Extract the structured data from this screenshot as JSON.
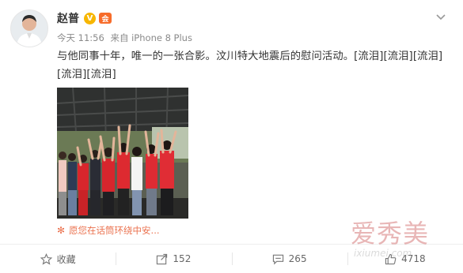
{
  "post": {
    "author_name": "赵普",
    "verified_badge": "V",
    "member_badge": "会",
    "time": "今天 11:56",
    "source": "来自 iPhone 8 Plus",
    "text_line1": "与他同事十年，唯一的一张合影。汶川特大地震后的慰问活动。[流泪][流泪][流泪]",
    "text_line2": "[流泪][流泪]",
    "ad_text": "愿您在话筒环绕中安...",
    "icons": {
      "avatar": "avatar-portrait",
      "verified": "verified-badge-icon",
      "member": "member-badge-icon",
      "menu": "chevron-down-icon",
      "ad": "flower-icon",
      "favorite": "star-icon",
      "repost": "share-icon",
      "comment": "comment-icon",
      "like": "thumbs-up-icon"
    },
    "colors": {
      "accent": "#eb7350",
      "verified": "#f7b600",
      "text": "#333333",
      "meta": "#8a8a8a"
    }
  },
  "actions": {
    "favorite_label": "收藏",
    "repost_count": "152",
    "comment_count": "265",
    "like_count": "4718"
  },
  "watermark": {
    "cn": "爱秀美",
    "url": "ixiumei.com"
  }
}
